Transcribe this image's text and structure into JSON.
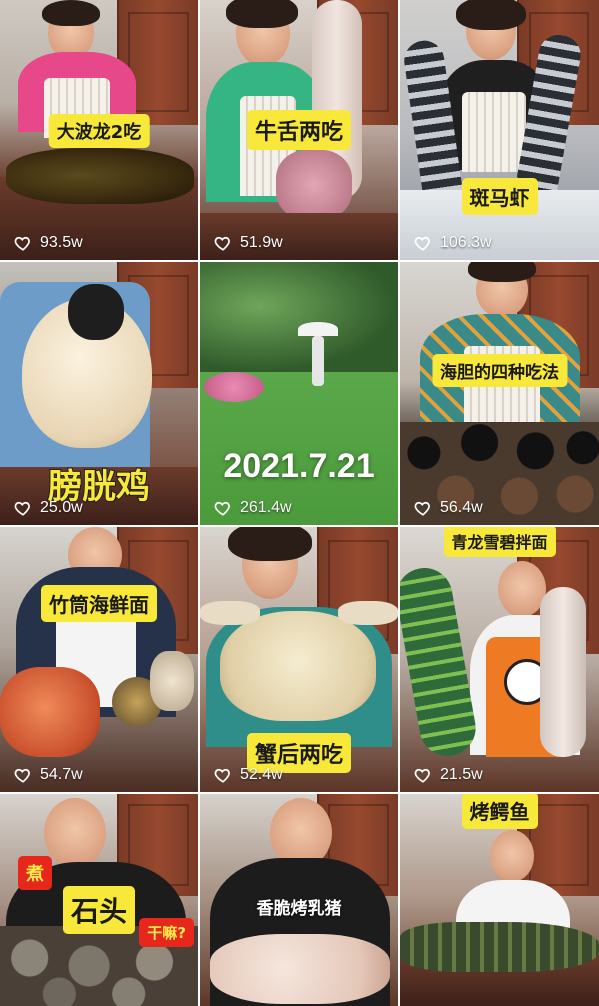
{
  "tiles": [
    {
      "caption": "大波龙2吃",
      "likes": "93.5w"
    },
    {
      "caption": "牛舌两吃",
      "likes": "51.9w"
    },
    {
      "caption": "斑马虾",
      "likes": "106.3w"
    },
    {
      "caption": "膀胱鸡",
      "likes": "25.0w"
    },
    {
      "caption": "2021.7.21",
      "likes": "261.4w"
    },
    {
      "caption": "海胆的四种吃法",
      "likes": "56.4w"
    },
    {
      "caption": "竹筒海鲜面",
      "likes": "54.7w"
    },
    {
      "caption": "蟹后两吃",
      "likes": "52.4w"
    },
    {
      "caption": "青龙雪碧拌面",
      "likes": "21.5w"
    },
    {
      "caption": "石头",
      "side_text_1": "煮",
      "side_text_2": "干嘛?",
      "likes": ""
    },
    {
      "caption": "香脆烤乳猪",
      "likes": ""
    },
    {
      "caption": "烤鳄鱼",
      "likes": ""
    }
  ],
  "icons": {
    "like": "heart-icon"
  },
  "colors": {
    "caption_yellow": "#f7e83a",
    "caption_red": "#e8271c",
    "like_text": "#ffffff"
  }
}
